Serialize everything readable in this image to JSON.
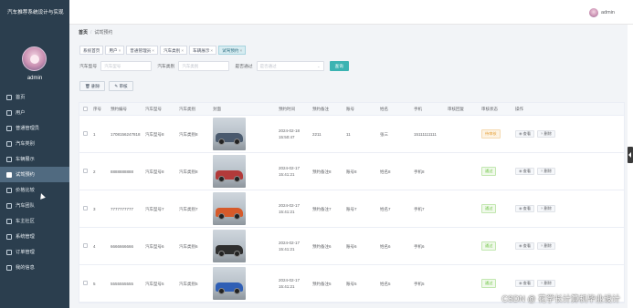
{
  "app": {
    "title": "汽车推荐系统设计与实现",
    "user": "admin"
  },
  "sidebar": {
    "items": [
      {
        "label": "首页",
        "icon": "home-icon"
      },
      {
        "label": "用户",
        "icon": "user-icon"
      },
      {
        "label": "普通管理员",
        "icon": "admin-icon"
      },
      {
        "label": "汽车类别",
        "icon": "category-icon"
      },
      {
        "label": "车辆展示",
        "icon": "car-icon"
      },
      {
        "label": "试驾预约",
        "icon": "calendar-icon",
        "active": true
      },
      {
        "label": "价格比较",
        "icon": "compare-icon"
      },
      {
        "label": "汽车团队",
        "icon": "team-icon"
      },
      {
        "label": "车主社区",
        "icon": "community-icon"
      },
      {
        "label": "系统管理",
        "icon": "settings-icon"
      },
      {
        "label": "订单管理",
        "icon": "order-icon"
      },
      {
        "label": "我的信息",
        "icon": "info-icon"
      }
    ]
  },
  "topbar": {
    "user": "admin"
  },
  "breadcrumb": {
    "home": "首页",
    "current": "试驾预约"
  },
  "tags": [
    {
      "label": "系统首页",
      "closable": false
    },
    {
      "label": "用户",
      "closable": true
    },
    {
      "label": "普通管理员",
      "closable": true
    },
    {
      "label": "汽车类别",
      "closable": true
    },
    {
      "label": "车辆展示",
      "closable": true
    },
    {
      "label": "试驾预约",
      "closable": true,
      "active": true
    }
  ],
  "search": {
    "model_label": "汽车型号",
    "model_placeholder": "汽车型号",
    "category_label": "汽车类别",
    "category_placeholder": "汽车类别",
    "pass_label": "是否通过",
    "pass_placeholder": "是否通过",
    "button": "查询"
  },
  "actions": {
    "delete": "删除",
    "review": "审核"
  },
  "table": {
    "headers": [
      "",
      "序号",
      "预约编号",
      "汽车型号",
      "汽车类别",
      "封面",
      "预约时间",
      "预约备注",
      "账号",
      "姓名",
      "手机",
      "审核回复",
      "审核状态",
      "操作"
    ],
    "rows": [
      {
        "index": "1",
        "order_no": "1708156247818",
        "model": "汽车型号8",
        "category": "汽车类别8",
        "cover_color": "#4a5a6e",
        "time_date": "2024-02-18",
        "time_clock": "15:50:47",
        "remark": "2211",
        "account": "11",
        "name": "张三",
        "phone": "15111111111",
        "reply": "",
        "status": "待审核",
        "status_type": "wait"
      },
      {
        "index": "2",
        "order_no": "8888888888",
        "model": "汽车型号8",
        "category": "汽车类别8",
        "cover_color": "#b23a3a",
        "time_date": "2024-02-17",
        "time_clock": "15:41:21",
        "remark": "预约备注8",
        "account": "账号8",
        "name": "姓名8",
        "phone": "手机8",
        "reply": "",
        "status": "通过",
        "status_type": "pass"
      },
      {
        "index": "3",
        "order_no": "7777777777",
        "model": "汽车型号7",
        "category": "汽车类别7",
        "cover_color": "#d65a2a",
        "time_date": "2024-02-17",
        "time_clock": "15:41:21",
        "remark": "预约备注7",
        "account": "账号7",
        "name": "姓名7",
        "phone": "手机7",
        "reply": "",
        "status": "通过",
        "status_type": "pass"
      },
      {
        "index": "4",
        "order_no": "6666666666",
        "model": "汽车型号6",
        "category": "汽车类别6",
        "cover_color": "#2e2e2e",
        "time_date": "2024-02-17",
        "time_clock": "15:41:21",
        "remark": "预约备注6",
        "account": "账号6",
        "name": "姓名6",
        "phone": "手机6",
        "reply": "",
        "status": "通过",
        "status_type": "pass"
      },
      {
        "index": "5",
        "order_no": "5555555555",
        "model": "汽车型号5",
        "category": "汽车类别5",
        "cover_color": "#2f5fb5",
        "time_date": "2024-02-17",
        "time_clock": "15:41:21",
        "remark": "预约备注5",
        "account": "账号5",
        "name": "姓名5",
        "phone": "手机5",
        "reply": "",
        "status": "通过",
        "status_type": "pass"
      }
    ],
    "ops": {
      "view": "查看",
      "delete": "删除"
    }
  },
  "watermark": "CSDN @ 花学长计算机毕业设计"
}
